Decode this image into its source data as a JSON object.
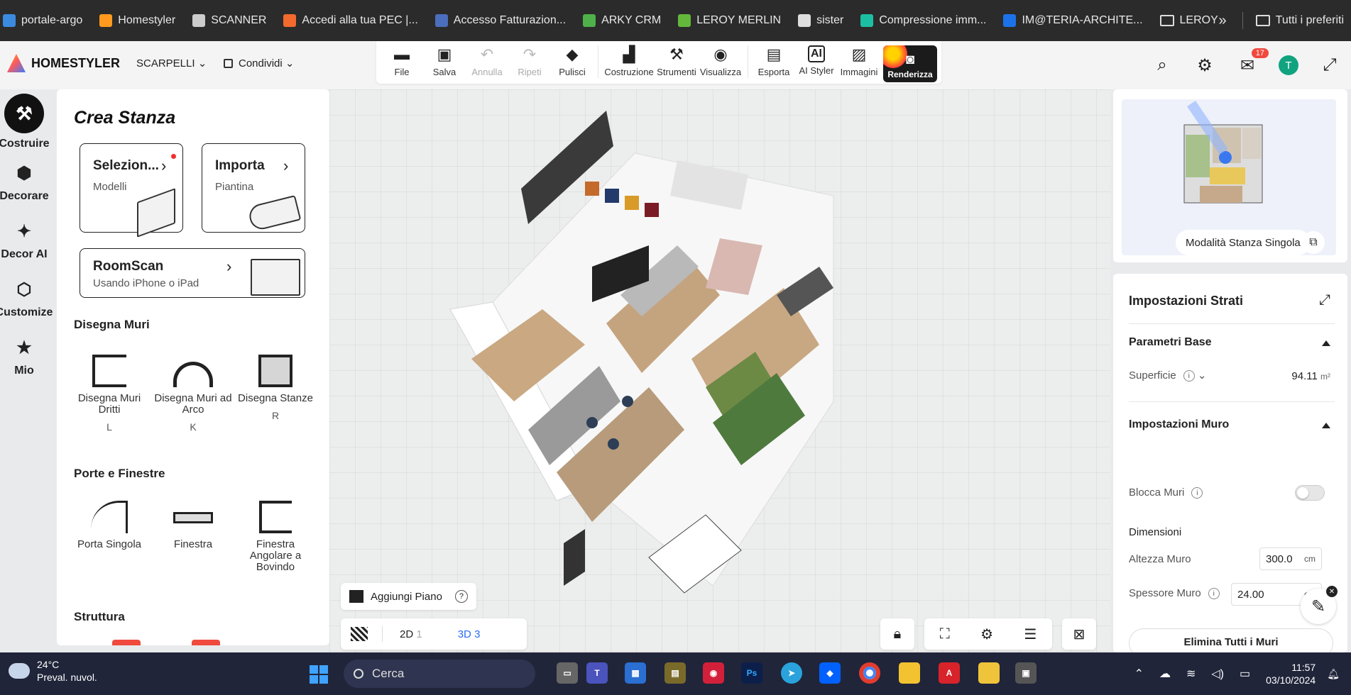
{
  "bookmarks": [
    {
      "label": "portale-argo",
      "color": "#3a8be0"
    },
    {
      "label": "Homestyler",
      "color": "#ff9a1f"
    },
    {
      "label": "SCANNER",
      "color": "#cccccc"
    },
    {
      "label": "Accedi alla tua PEC |...",
      "color": "#f26a2e"
    },
    {
      "label": "Accesso Fatturazion...",
      "color": "#4b6ebd"
    },
    {
      "label": "ARKY CRM",
      "color": "#4fb04a"
    },
    {
      "label": "LEROY MERLIN",
      "color": "#63b83b"
    },
    {
      "label": "sister",
      "color": "#dddddd"
    },
    {
      "label": "Compressione imm...",
      "color": "#1dbfa3"
    },
    {
      "label": "IM@TERIA-ARCHITE...",
      "color": "#1c73e8"
    },
    {
      "label": "LEROY",
      "color": "folder"
    }
  ],
  "bookmarks_more": "»",
  "bookmarks_all": "Tutti i preferiti",
  "app": {
    "brand": "HOMESTYLER",
    "project": "SCARPELLI",
    "share": "Condividi"
  },
  "toolbar": {
    "file": "File",
    "save": "Salva",
    "undo": "Annulla",
    "redo": "Ripeti",
    "clear": "Pulisci",
    "build": "Costruzione",
    "tools": "Strumenti",
    "view": "Visualizza",
    "export": "Esporta",
    "ai_styler": "AI Styler",
    "images": "Immagini",
    "render": "Renderizza"
  },
  "header_right": {
    "notifications": "17",
    "avatar": "T"
  },
  "rail": [
    {
      "label": "Costruire",
      "icon": "hammer-icon"
    },
    {
      "label": "Decorare",
      "icon": "cube-icon"
    },
    {
      "label": "Decor AI",
      "icon": "ai-cube-icon"
    },
    {
      "label": "Customize",
      "icon": "customize-icon"
    },
    {
      "label": "Mio",
      "icon": "star-box-icon"
    }
  ],
  "panel": {
    "title": "Crea Stanza",
    "select_title": "Selezion...",
    "select_sub": "Modelli",
    "import_title": "Importa",
    "import_sub": "Piantina",
    "roomscan_title": "RoomScan",
    "roomscan_sub": "Usando iPhone o iPad",
    "walls_section": "Disegna Muri",
    "walls": [
      {
        "label": "Disegna Muri Dritti",
        "key": "L"
      },
      {
        "label": "Disegna Muri ad Arco",
        "key": "K"
      },
      {
        "label": "Disegna Stanze",
        "key": "R"
      }
    ],
    "doors_section": "Porte e Finestre",
    "doors": [
      {
        "label": "Porta Singola"
      },
      {
        "label": "Finestra"
      },
      {
        "label": "Finestra Angolare a Bovindo"
      }
    ],
    "structure_section": "Struttura"
  },
  "viewport": {
    "add_floor": "Aggiungi Piano",
    "help": "?",
    "view_2d": "2D",
    "view_2d_count": "1",
    "view_3d": "3D",
    "view_3d_count": "3"
  },
  "minimap": {
    "mode": "Modalità Stanza Singola"
  },
  "layers": {
    "title": "Impostazioni Strati",
    "base_params": "Parametri Base",
    "surface_label": "Superficie",
    "surface_value": "94.11",
    "surface_unit": "m²",
    "wall_settings": "Impostazioni Muro",
    "lock_walls": "Blocca Muri",
    "dimensions": "Dimensioni",
    "wall_height_label": "Altezza Muro",
    "wall_height_value": "300.0",
    "wall_thickness_label": "Spessore Muro",
    "wall_thickness_value": "24.00",
    "unit_cm": "cm",
    "delete_all": "Elimina Tutti i Muri"
  },
  "taskbar": {
    "temp": "24°C",
    "weather": "Preval. nuvol.",
    "search": "Cerca",
    "time": "11:57",
    "date": "03/10/2024"
  }
}
